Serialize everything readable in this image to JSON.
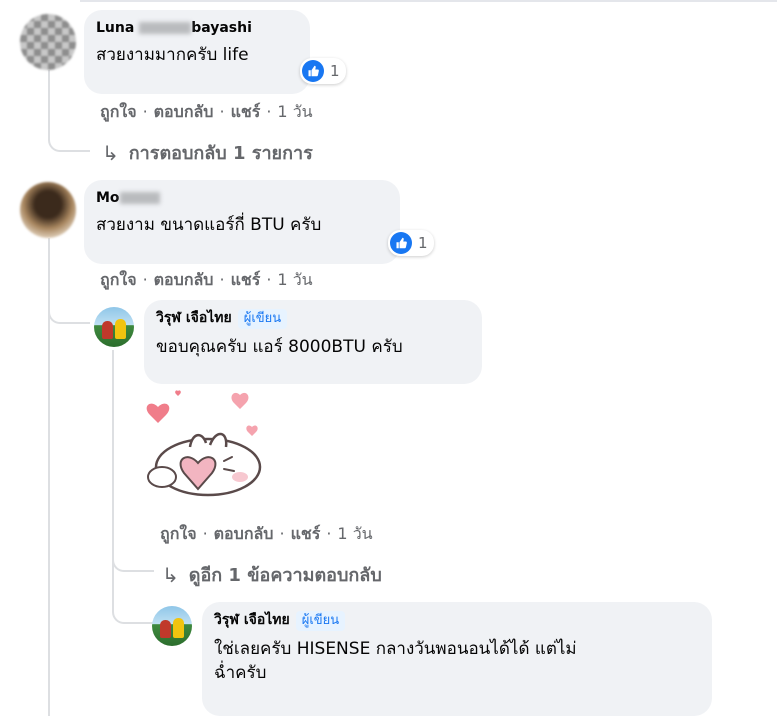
{
  "comments": [
    {
      "name_prefix": "Luna",
      "name_suffix": "bayashi",
      "text": "สวยงามมากครับ life",
      "reaction_count": "1",
      "actions": {
        "like": "ถูกใจ",
        "reply": "ตอบกลับ",
        "share": "แชร์",
        "time": "1 วัน"
      },
      "replies_link": "การตอบกลับ 1 รายการ"
    },
    {
      "name_prefix": "Mo",
      "text": "สวยงาม ขนาดแอร์กี่ BTU ครับ",
      "reaction_count": "1",
      "actions": {
        "like": "ถูกใจ",
        "reply": "ตอบกลับ",
        "share": "แชร์",
        "time": "1 วัน"
      },
      "replies": [
        {
          "name": "วิรุฬ เจือไทย",
          "badge": "ผู้เขียน",
          "text": "ขอบคุณครับ แอร์ 8000BTU ครับ",
          "sticker": "heart-bear-sticker",
          "actions": {
            "like": "ถูกใจ",
            "reply": "ตอบกลับ",
            "share": "แชร์",
            "time": "1 วัน"
          },
          "more_replies_link": "ดูอีก 1 ข้อความตอบกลับ"
        },
        {
          "name": "วิรุฬ เจือไทย",
          "badge": "ผู้เขียน",
          "text_line1": "ใช่เลยครับ HISENSE กลางวันพอนอนได้ได้ แต่ไม่",
          "text_line2": "ฉ่ำครับ"
        }
      ]
    }
  ],
  "icons": {
    "reaction": "like-thumb-icon",
    "reply_arrow": "reply-arrow-icon"
  },
  "colors": {
    "accent": "#1877f2",
    "bubble": "#f0f2f5",
    "meta": "#65676b"
  }
}
